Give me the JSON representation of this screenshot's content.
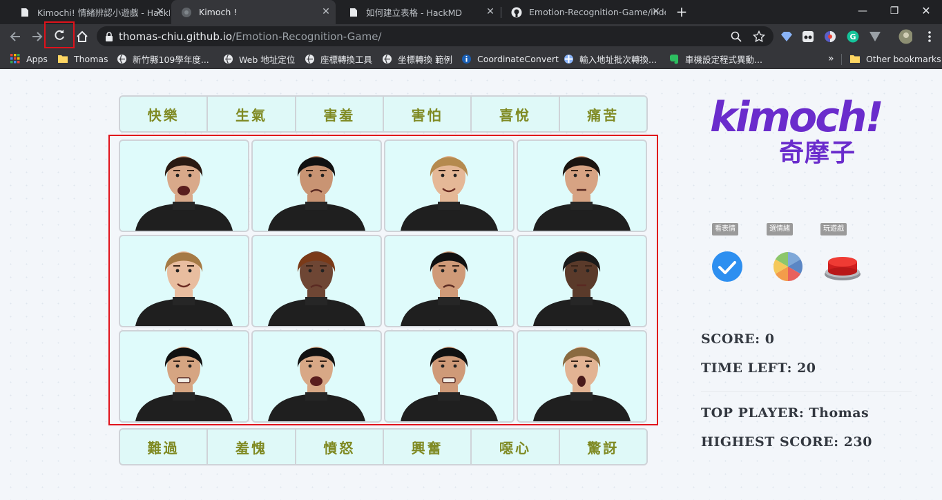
{
  "tabs": [
    {
      "title": "Kimochi! 情緒辨認小遊戲 - HackMD",
      "icon": "document-icon"
    },
    {
      "title": "Kimoch !",
      "icon": "globe-icon"
    },
    {
      "title": "如何建立表格 - HackMD",
      "icon": "document-icon"
    },
    {
      "title": "Emotion-Recognition-Game/index.html",
      "icon": "github-icon"
    }
  ],
  "omnibox": {
    "host": "thomas-chiu.github.io",
    "path": "/Emotion-Recognition-Game/"
  },
  "bookmarks": [
    {
      "label": "Apps",
      "icon": "apps-grid-icon"
    },
    {
      "label": "Thomas",
      "icon": "folder-icon"
    },
    {
      "label": "新竹縣109學年度...",
      "icon": "globe-icon"
    },
    {
      "label": "Web 地址定位",
      "icon": "globe-icon"
    },
    {
      "label": "座標轉換工具",
      "icon": "globe-icon"
    },
    {
      "label": "坐標轉換 範例",
      "icon": "globe-icon"
    },
    {
      "label": "CoordinateConvert",
      "icon": "info-icon"
    },
    {
      "label": "輸入地址批次轉換...",
      "icon": "app-icon"
    },
    {
      "label": "車機設定程式異動...",
      "icon": "evernote-icon"
    }
  ],
  "other_bookmarks": "Other bookmarks",
  "emotions_top": [
    "快樂",
    "生氣",
    "害羞",
    "害怕",
    "喜悅",
    "痛苦"
  ],
  "emotions_bottom": [
    "難過",
    "羞愧",
    "憤怒",
    "興奮",
    "噁心",
    "驚訝"
  ],
  "logo": {
    "wordmark": "kimoch!",
    "subtitle": "奇摩子"
  },
  "modes": [
    {
      "label": "看表情",
      "icon": "checkmark-circle-icon"
    },
    {
      "label": "選情緒",
      "icon": "color-wheel-icon"
    },
    {
      "label": "玩遊戲",
      "icon": "red-button-icon"
    }
  ],
  "stats": {
    "score": "SCORE: 0",
    "time_left": "TIME LEFT: 20",
    "top_player": "TOP PLAYER: Thomas",
    "highest_score": "HIGHEST SCORE: 230"
  },
  "colors": {
    "accent": "#6a2ccc",
    "label_text": "#7f8a23",
    "card_bg": "#dffbfb",
    "highlight": "#e0121b"
  }
}
